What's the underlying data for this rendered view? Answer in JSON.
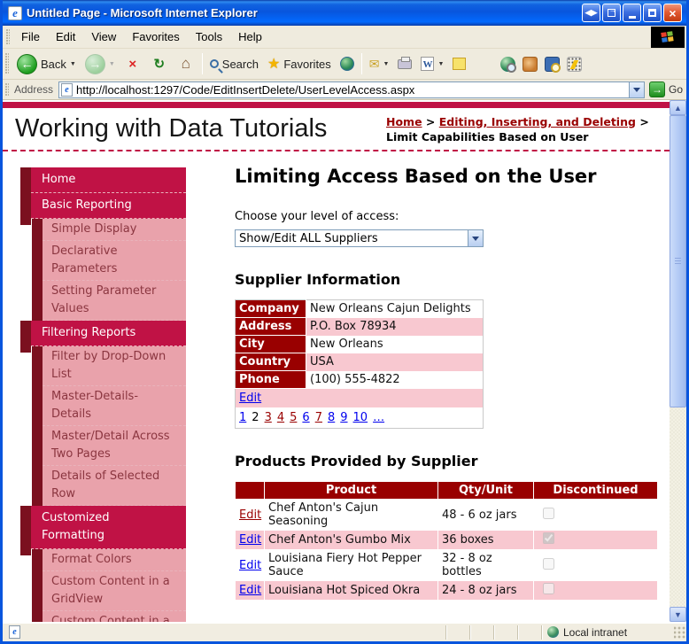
{
  "window": {
    "title": "Untitled Page - Microsoft Internet Explorer"
  },
  "icons": {
    "ie_logo": "e",
    "resize": "◀▶",
    "popout_arrow": "→",
    "close": "×",
    "back_arrow": "←",
    "forward_arrow": "→",
    "stop": "×",
    "refresh": "↻",
    "home": "⌂",
    "favorites_star": "★",
    "mail": "✉",
    "word": "W",
    "caret": "▼",
    "go_arrow": "→",
    "scroll_up": "▲",
    "scroll_down": "▼",
    "page": "e"
  },
  "menu": {
    "items": [
      "File",
      "Edit",
      "View",
      "Favorites",
      "Tools",
      "Help"
    ]
  },
  "toolbar": {
    "back_label": "Back",
    "search_label": "Search",
    "favorites_label": "Favorites"
  },
  "address": {
    "label": "Address",
    "url": "http://localhost:1297/Code/EditInsertDelete/UserLevelAccess.aspx",
    "go_label": "Go"
  },
  "header": {
    "site_title": "Working with Data Tutorials",
    "breadcrumb": {
      "link1": "Home",
      "link2": "Editing, Inserting, and Deleting",
      "separator": ">",
      "current": "Limit Capabilities Based on User"
    }
  },
  "sidebar": {
    "items": [
      {
        "label": "Home",
        "level": 1
      },
      {
        "label": "Basic Reporting",
        "level": 1
      },
      {
        "label": "Simple Display",
        "level": 2
      },
      {
        "label": "Declarative Parameters",
        "level": 2
      },
      {
        "label": "Setting Parameter Values",
        "level": 2
      },
      {
        "label": "Filtering Reports",
        "level": 1
      },
      {
        "label": "Filter by Drop-Down List",
        "level": 2
      },
      {
        "label": "Master-Details-Details",
        "level": 2
      },
      {
        "label": "Master/Detail Across Two Pages",
        "level": 2
      },
      {
        "label": "Details of Selected Row",
        "level": 2
      },
      {
        "label": "Customized Formatting",
        "level": 1
      },
      {
        "label": "Format Colors",
        "level": 2
      },
      {
        "label": "Custom Content in a GridView",
        "level": 2
      },
      {
        "label": "Custom Content in a DetailsView",
        "level": 2
      }
    ]
  },
  "main": {
    "page_title": "Limiting Access Based on the User",
    "access_label": "Choose your level of access:",
    "access_select": {
      "value": "Show/Edit ALL Suppliers"
    },
    "supplier_section": {
      "heading": "Supplier Information",
      "fields": [
        {
          "label": "Company",
          "value": "New Orleans Cajun Delights"
        },
        {
          "label": "Address",
          "value": "P.O. Box 78934"
        },
        {
          "label": "City",
          "value": "New Orleans"
        },
        {
          "label": "Country",
          "value": "USA"
        },
        {
          "label": "Phone",
          "value": "(100) 555-4822"
        }
      ],
      "edit_label": "Edit",
      "pager": [
        {
          "text": "1",
          "state": "link"
        },
        {
          "text": "2",
          "state": "current"
        },
        {
          "text": "3",
          "state": "visited"
        },
        {
          "text": "4",
          "state": "visited"
        },
        {
          "text": "5",
          "state": "visited"
        },
        {
          "text": "6",
          "state": "link"
        },
        {
          "text": "7",
          "state": "visited"
        },
        {
          "text": "8",
          "state": "link"
        },
        {
          "text": "9",
          "state": "link"
        },
        {
          "text": "10",
          "state": "link"
        },
        {
          "text": "…",
          "state": "link"
        }
      ]
    },
    "products_section": {
      "heading": "Products Provided by Supplier",
      "columns": [
        "",
        "Product",
        "Qty/Unit",
        "Discontinued"
      ],
      "edit_label": "Edit",
      "rows": [
        {
          "edit_state": "visited",
          "product": "Chef Anton's Cajun Seasoning",
          "qty": "48 - 6 oz jars",
          "discontinued": false
        },
        {
          "edit_state": "link",
          "product": "Chef Anton's Gumbo Mix",
          "qty": "36 boxes",
          "discontinued": true
        },
        {
          "edit_state": "link",
          "product": "Louisiana Fiery Hot Pepper Sauce",
          "qty": "32 - 8 oz bottles",
          "discontinued": false
        },
        {
          "edit_state": "link",
          "product": "Louisiana Hot Spiced Okra",
          "qty": "24 - 8 oz jars",
          "discontinued": false
        }
      ]
    }
  },
  "status": {
    "zone_label": "Local intranet"
  },
  "colors": {
    "titlebar_blue": "#0855DD",
    "chrome_bg": "#EFEBDE",
    "crimson": "#C01245",
    "maroon_accent": "#7B101F",
    "table_header_red": "#990000",
    "row_pink": "#F8C8D0",
    "sidebar_pink": "#E9A2AB",
    "sidebar_sub_text": "#8B3640",
    "link_blue": "#0000EE",
    "link_visited": "#990000"
  }
}
